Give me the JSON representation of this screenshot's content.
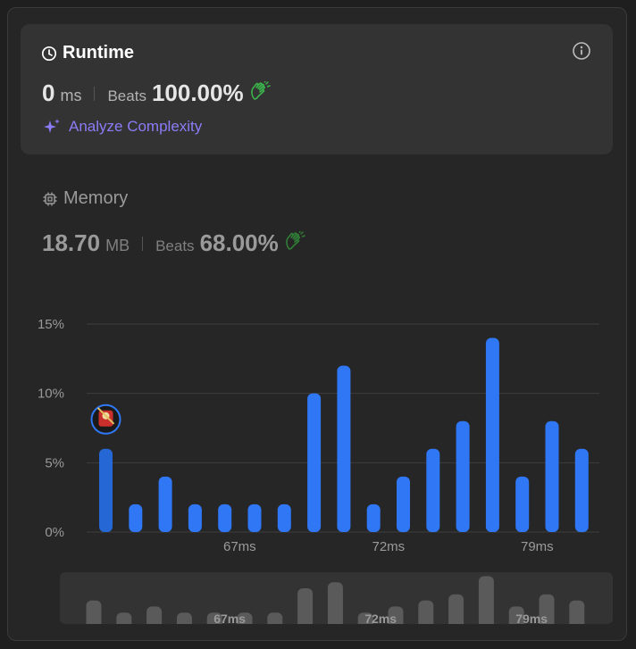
{
  "runtime": {
    "title": "Runtime",
    "value": "0",
    "unit": "ms",
    "beats_label": "Beats",
    "beats_value": "100.00%",
    "analyze_label": "Analyze Complexity",
    "icons": [
      "clock-icon",
      "info-icon",
      "clap-icon",
      "sparkle-icon"
    ]
  },
  "memory": {
    "title": "Memory",
    "value": "18.70",
    "unit": "MB",
    "beats_label": "Beats",
    "beats_value": "68.00%",
    "icons": [
      "chip-icon",
      "clap-icon"
    ]
  },
  "colors": {
    "accent": "#2f77f5",
    "accent_dim": "#2667d6",
    "clap": "#3bb24a",
    "purple": "#8b7cf6",
    "minimap_bar": "#5a5a5a"
  },
  "chart_data": {
    "type": "bar",
    "title": "",
    "xlabel": "",
    "ylabel": "",
    "ylim": [
      0,
      15
    ],
    "y_ticks": [
      "15%",
      "10%",
      "5%",
      "0%"
    ],
    "y_tick_values": [
      15,
      10,
      5,
      0
    ],
    "x_tick_labels": [
      {
        "label": "67ms",
        "index": 4.5
      },
      {
        "label": "72ms",
        "index": 9.5
      },
      {
        "label": "79ms",
        "index": 14.5
      }
    ],
    "values": [
      6,
      2,
      4,
      2,
      2,
      2,
      2,
      10,
      12,
      2,
      4,
      6,
      8,
      14,
      4,
      8,
      6
    ],
    "highlight_index": 0,
    "grid": true
  },
  "minimap": {
    "tick_labels": [
      "67ms",
      "72ms",
      "79ms"
    ]
  }
}
